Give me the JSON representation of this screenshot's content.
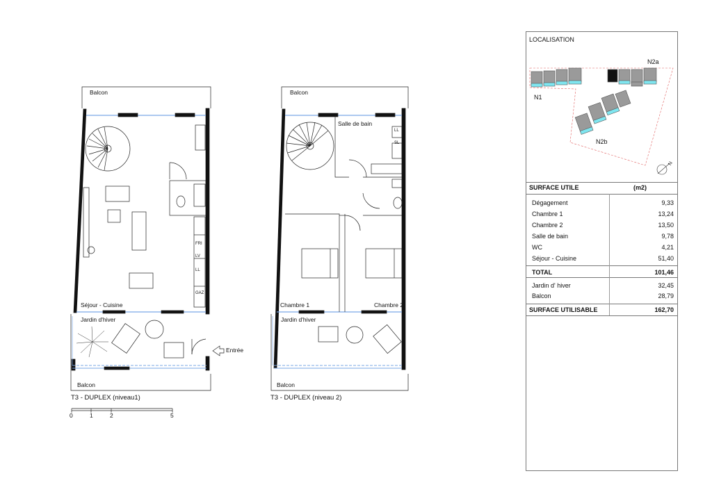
{
  "plan1": {
    "balcon_top": "Balcon",
    "sejour": "Séjour - Cuisine",
    "jardin": "Jardin d'hiver",
    "entree": "Entrée",
    "balcon_bottom": "Balcon",
    "appliances": [
      "FRI",
      "LV",
      "LL",
      "GAZ"
    ],
    "caption": "T3 - DUPLEX (niveau1)"
  },
  "plan2": {
    "balcon_top": "Balcon",
    "salle_de_bain": "Salle de bain",
    "chambre1": "Chambre 1",
    "chambre2": "Chambre 2",
    "jardin": "Jardin d'hiver",
    "balcon_bottom": "Balcon",
    "fixtures": [
      "LL",
      "SL"
    ],
    "caption": "T3 - DUPLEX (niveau 2)"
  },
  "scale": {
    "ticks": [
      "0",
      "1",
      "2",
      "5"
    ]
  },
  "localisation": {
    "title": "LOCALISATION",
    "labels": [
      "N1",
      "N2a",
      "N2b"
    ],
    "north": "N"
  },
  "surface_table": {
    "header_label": "SURFACE UTILE",
    "header_unit": "(m2)",
    "rows": [
      {
        "name": "Dégagement",
        "value": "9,33"
      },
      {
        "name": "Chambre 1",
        "value": "13,24"
      },
      {
        "name": "Chambre 2",
        "value": "13,50"
      },
      {
        "name": "Salle de bain",
        "value": "9,78"
      },
      {
        "name": "WC",
        "value": "4,21"
      },
      {
        "name": "Séjour - Cuisine",
        "value": "51,40"
      }
    ],
    "total_label": "TOTAL",
    "total_value": "101,46",
    "extra_rows": [
      {
        "name": "Jardin d' hiver",
        "value": "32,45"
      },
      {
        "name": "Balcon",
        "value": "28,79"
      }
    ],
    "usable_label": "SURFACE UTILISABLE",
    "usable_value": "162,70"
  },
  "colors": {
    "wall": "#111111",
    "glazing": "#7aa7e6",
    "building_grey": "#9a9a9a",
    "building_cyan": "#7fe6f0",
    "plot_red": "#e06060"
  }
}
